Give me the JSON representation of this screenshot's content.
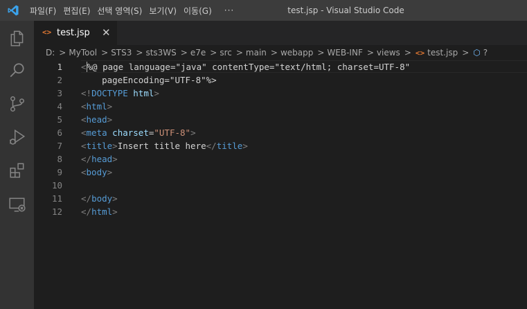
{
  "titlebar": {
    "menu": [
      "파일(F)",
      "편집(E)",
      "선택 영역(S)",
      "보기(V)",
      "이동(G)"
    ],
    "more": "···",
    "window_title": "test.jsp - Visual Studio Code"
  },
  "activity_bar": {
    "icons": [
      "explorer-icon",
      "search-icon",
      "source-control-icon",
      "run-debug-icon",
      "extensions-icon",
      "remote-explorer-icon"
    ]
  },
  "tab": {
    "icon": "<>",
    "label": "test.jsp",
    "close": "✕"
  },
  "breadcrumb": {
    "items": [
      "D:",
      "MyTool",
      "STS3",
      "sts3WS",
      "e7e",
      "src",
      "main",
      "webapp",
      "WEB-INF",
      "views"
    ],
    "separator": ">",
    "file": "test.jsp",
    "symbol": "?"
  },
  "editor": {
    "active_line": 1,
    "lines": [
      {
        "n": "1",
        "tokens": [
          [
            "br",
            "<"
          ],
          [
            "txt",
            "%@ page language=\"java\" contentType=\"text/html; charset=UTF-8\""
          ]
        ]
      },
      {
        "n": "2",
        "tokens": [
          [
            "txt",
            "    pageEncoding=\"UTF-8\"%>"
          ]
        ]
      },
      {
        "n": "3",
        "tokens": [
          [
            "br",
            "<!"
          ],
          [
            "tag",
            "DOCTYPE"
          ],
          [
            "txt",
            " "
          ],
          [
            "attr",
            "html"
          ],
          [
            "br",
            ">"
          ]
        ]
      },
      {
        "n": "4",
        "tokens": [
          [
            "br",
            "<"
          ],
          [
            "tag",
            "html"
          ],
          [
            "br",
            ">"
          ]
        ]
      },
      {
        "n": "5",
        "tokens": [
          [
            "br",
            "<"
          ],
          [
            "tag",
            "head"
          ],
          [
            "br",
            ">"
          ]
        ]
      },
      {
        "n": "6",
        "tokens": [
          [
            "br",
            "<"
          ],
          [
            "tag",
            "meta"
          ],
          [
            "txt",
            " "
          ],
          [
            "attr",
            "charset"
          ],
          [
            "txt",
            "="
          ],
          [
            "str",
            "\"UTF-8\""
          ],
          [
            "br",
            ">"
          ]
        ]
      },
      {
        "n": "7",
        "tokens": [
          [
            "br",
            "<"
          ],
          [
            "tag",
            "title"
          ],
          [
            "br",
            ">"
          ],
          [
            "txt",
            "Insert title here"
          ],
          [
            "br",
            "</"
          ],
          [
            "tag",
            "title"
          ],
          [
            "br",
            ">"
          ]
        ]
      },
      {
        "n": "8",
        "tokens": [
          [
            "br",
            "</"
          ],
          [
            "tag",
            "head"
          ],
          [
            "br",
            ">"
          ]
        ]
      },
      {
        "n": "9",
        "tokens": [
          [
            "br",
            "<"
          ],
          [
            "tag",
            "body"
          ],
          [
            "br",
            ">"
          ]
        ]
      },
      {
        "n": "10",
        "tokens": []
      },
      {
        "n": "11",
        "tokens": [
          [
            "br",
            "</"
          ],
          [
            "tag",
            "body"
          ],
          [
            "br",
            ">"
          ]
        ]
      },
      {
        "n": "12",
        "tokens": [
          [
            "br",
            "</"
          ],
          [
            "tag",
            "html"
          ],
          [
            "br",
            ">"
          ]
        ]
      }
    ]
  }
}
